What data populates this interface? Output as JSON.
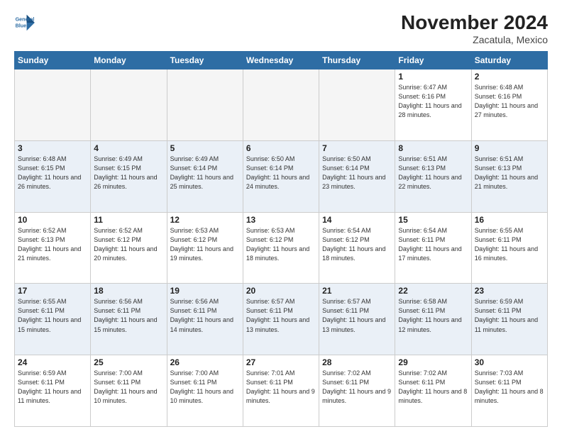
{
  "logo": {
    "line1": "General",
    "line2": "Blue"
  },
  "title": "November 2024",
  "location": "Zacatula, Mexico",
  "days_of_week": [
    "Sunday",
    "Monday",
    "Tuesday",
    "Wednesday",
    "Thursday",
    "Friday",
    "Saturday"
  ],
  "weeks": [
    [
      {
        "day": "",
        "info": ""
      },
      {
        "day": "",
        "info": ""
      },
      {
        "day": "",
        "info": ""
      },
      {
        "day": "",
        "info": ""
      },
      {
        "day": "",
        "info": ""
      },
      {
        "day": "1",
        "info": "Sunrise: 6:47 AM\nSunset: 6:16 PM\nDaylight: 11 hours\nand 28 minutes."
      },
      {
        "day": "2",
        "info": "Sunrise: 6:48 AM\nSunset: 6:16 PM\nDaylight: 11 hours\nand 27 minutes."
      }
    ],
    [
      {
        "day": "3",
        "info": "Sunrise: 6:48 AM\nSunset: 6:15 PM\nDaylight: 11 hours\nand 26 minutes."
      },
      {
        "day": "4",
        "info": "Sunrise: 6:49 AM\nSunset: 6:15 PM\nDaylight: 11 hours\nand 26 minutes."
      },
      {
        "day": "5",
        "info": "Sunrise: 6:49 AM\nSunset: 6:14 PM\nDaylight: 11 hours\nand 25 minutes."
      },
      {
        "day": "6",
        "info": "Sunrise: 6:50 AM\nSunset: 6:14 PM\nDaylight: 11 hours\nand 24 minutes."
      },
      {
        "day": "7",
        "info": "Sunrise: 6:50 AM\nSunset: 6:14 PM\nDaylight: 11 hours\nand 23 minutes."
      },
      {
        "day": "8",
        "info": "Sunrise: 6:51 AM\nSunset: 6:13 PM\nDaylight: 11 hours\nand 22 minutes."
      },
      {
        "day": "9",
        "info": "Sunrise: 6:51 AM\nSunset: 6:13 PM\nDaylight: 11 hours\nand 21 minutes."
      }
    ],
    [
      {
        "day": "10",
        "info": "Sunrise: 6:52 AM\nSunset: 6:13 PM\nDaylight: 11 hours\nand 21 minutes."
      },
      {
        "day": "11",
        "info": "Sunrise: 6:52 AM\nSunset: 6:12 PM\nDaylight: 11 hours\nand 20 minutes."
      },
      {
        "day": "12",
        "info": "Sunrise: 6:53 AM\nSunset: 6:12 PM\nDaylight: 11 hours\nand 19 minutes."
      },
      {
        "day": "13",
        "info": "Sunrise: 6:53 AM\nSunset: 6:12 PM\nDaylight: 11 hours\nand 18 minutes."
      },
      {
        "day": "14",
        "info": "Sunrise: 6:54 AM\nSunset: 6:12 PM\nDaylight: 11 hours\nand 18 minutes."
      },
      {
        "day": "15",
        "info": "Sunrise: 6:54 AM\nSunset: 6:11 PM\nDaylight: 11 hours\nand 17 minutes."
      },
      {
        "day": "16",
        "info": "Sunrise: 6:55 AM\nSunset: 6:11 PM\nDaylight: 11 hours\nand 16 minutes."
      }
    ],
    [
      {
        "day": "17",
        "info": "Sunrise: 6:55 AM\nSunset: 6:11 PM\nDaylight: 11 hours\nand 15 minutes."
      },
      {
        "day": "18",
        "info": "Sunrise: 6:56 AM\nSunset: 6:11 PM\nDaylight: 11 hours\nand 15 minutes."
      },
      {
        "day": "19",
        "info": "Sunrise: 6:56 AM\nSunset: 6:11 PM\nDaylight: 11 hours\nand 14 minutes."
      },
      {
        "day": "20",
        "info": "Sunrise: 6:57 AM\nSunset: 6:11 PM\nDaylight: 11 hours\nand 13 minutes."
      },
      {
        "day": "21",
        "info": "Sunrise: 6:57 AM\nSunset: 6:11 PM\nDaylight: 11 hours\nand 13 minutes."
      },
      {
        "day": "22",
        "info": "Sunrise: 6:58 AM\nSunset: 6:11 PM\nDaylight: 11 hours\nand 12 minutes."
      },
      {
        "day": "23",
        "info": "Sunrise: 6:59 AM\nSunset: 6:11 PM\nDaylight: 11 hours\nand 11 minutes."
      }
    ],
    [
      {
        "day": "24",
        "info": "Sunrise: 6:59 AM\nSunset: 6:11 PM\nDaylight: 11 hours\nand 11 minutes."
      },
      {
        "day": "25",
        "info": "Sunrise: 7:00 AM\nSunset: 6:11 PM\nDaylight: 11 hours\nand 10 minutes."
      },
      {
        "day": "26",
        "info": "Sunrise: 7:00 AM\nSunset: 6:11 PM\nDaylight: 11 hours\nand 10 minutes."
      },
      {
        "day": "27",
        "info": "Sunrise: 7:01 AM\nSunset: 6:11 PM\nDaylight: 11 hours\nand 9 minutes."
      },
      {
        "day": "28",
        "info": "Sunrise: 7:02 AM\nSunset: 6:11 PM\nDaylight: 11 hours\nand 9 minutes."
      },
      {
        "day": "29",
        "info": "Sunrise: 7:02 AM\nSunset: 6:11 PM\nDaylight: 11 hours\nand 8 minutes."
      },
      {
        "day": "30",
        "info": "Sunrise: 7:03 AM\nSunset: 6:11 PM\nDaylight: 11 hours\nand 8 minutes."
      }
    ]
  ]
}
